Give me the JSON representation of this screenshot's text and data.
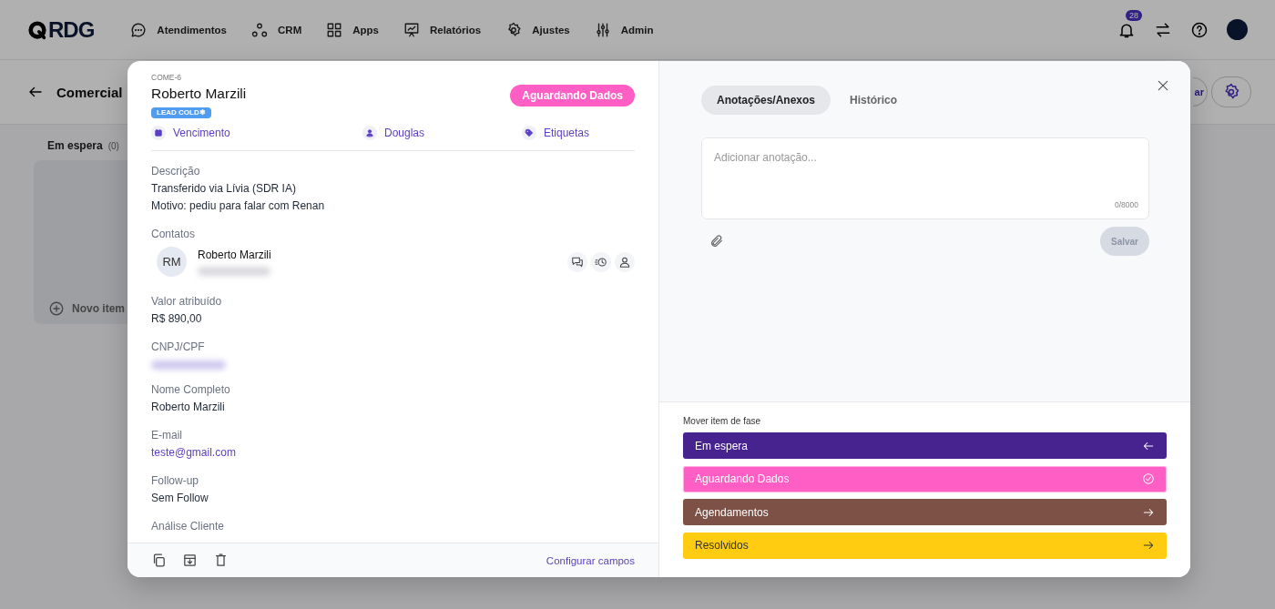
{
  "header": {
    "logo": "RDG",
    "nav": [
      {
        "label": "Atendimentos"
      },
      {
        "label": "CRM"
      },
      {
        "label": "Apps"
      },
      {
        "label": "Relatórios"
      },
      {
        "label": "Ajustes"
      },
      {
        "label": "Admin"
      }
    ],
    "notification_count": "28"
  },
  "board": {
    "title": "Comercial",
    "partial_button": "ar",
    "column": {
      "name": "Em espera",
      "count": "(0)",
      "add_label": "Novo item"
    }
  },
  "card": {
    "code": "COME-6",
    "title": "Roberto Marzili",
    "tag": "LEAD COLD❄",
    "status": {
      "label": "Aguardando Dados",
      "color": "#ff5ec4"
    },
    "meta": [
      {
        "label": "Vencimento"
      },
      {
        "label": "Douglas"
      },
      {
        "label": "Etiquetas"
      }
    ],
    "fields": [
      {
        "kind": "text",
        "label": "Descrição",
        "lines": [
          "Transferido via Lívia (SDR IA)",
          "Motivo: pediu para falar com Renan"
        ]
      },
      {
        "kind": "contacts",
        "label": "Contatos",
        "contacts": [
          {
            "initials": "RM",
            "name": "Roberto Marzili"
          }
        ]
      },
      {
        "kind": "text",
        "label": "Valor atribuído",
        "lines": [
          "R$ 890,00"
        ]
      },
      {
        "kind": "blurred",
        "label": "CNPJ/CPF"
      },
      {
        "kind": "text",
        "label": "Nome Completo",
        "lines": [
          "Roberto Marzili"
        ]
      },
      {
        "kind": "link",
        "label": "E-mail",
        "lines": [
          "teste@gmail.com"
        ]
      },
      {
        "kind": "text",
        "label": "Follow-up",
        "lines": [
          "Sem Follow"
        ]
      },
      {
        "kind": "text",
        "label": "Análise Cliente"
      }
    ],
    "footer_link": "Configurar campos"
  },
  "notes": {
    "tabs": [
      {
        "label": "Anotações/Anexos",
        "selected": true
      },
      {
        "label": "Histórico",
        "selected": false
      }
    ],
    "placeholder": "Adicionar anotação...",
    "counter": "0/8000",
    "save": {
      "label": "Salvar",
      "disabled": true
    }
  },
  "phases": {
    "title": "Mover item de fase",
    "items": [
      {
        "label": "Em espera",
        "color": "#46238f",
        "kind": "back",
        "selected": false
      },
      {
        "label": "Aguardando Dados",
        "color": "#ff5ec4",
        "kind": "current",
        "selected": true
      },
      {
        "label": "Agendamentos",
        "color": "#7d5146",
        "kind": "forward",
        "selected": false
      },
      {
        "label": "Resolvidos",
        "color": "#ffcc11",
        "kind": "forward",
        "selected": false
      }
    ]
  }
}
